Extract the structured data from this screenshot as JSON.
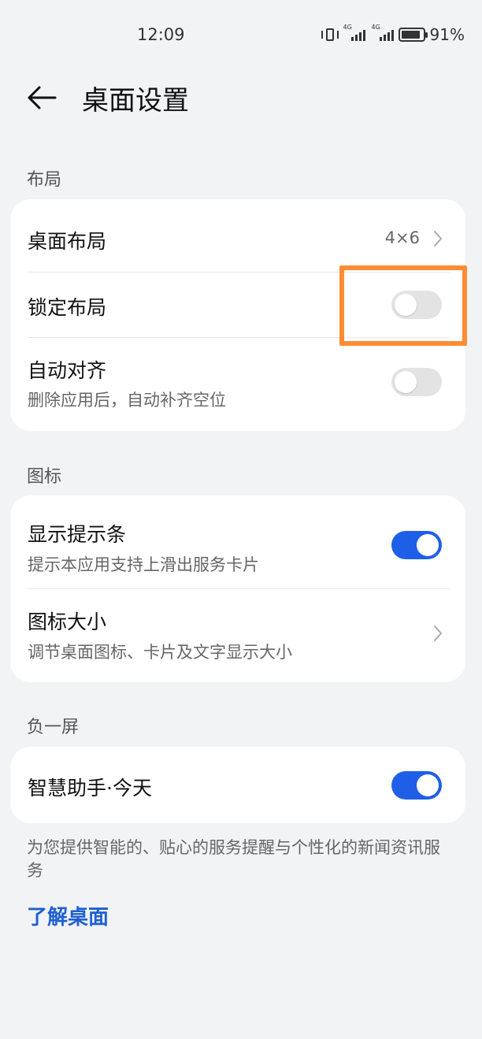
{
  "status_bar": {
    "time": "12:09",
    "battery_percent": "91%",
    "battery_level": 0.91,
    "network_labels": [
      "4G",
      "4G"
    ],
    "icons": [
      "vibrate-icon",
      "signal-icon",
      "signal-icon",
      "battery-icon"
    ]
  },
  "header": {
    "title": "桌面设置",
    "back_icon": "arrow-left-icon"
  },
  "sections": {
    "layout": {
      "header": "布局",
      "items": {
        "desktop_layout": {
          "title": "桌面布局",
          "value": "4×6"
        },
        "lock_layout": {
          "title": "锁定布局",
          "toggle": false
        },
        "auto_align": {
          "title": "自动对齐",
          "subtitle": "删除应用后，自动补齐空位",
          "toggle": false
        }
      }
    },
    "icons": {
      "header": "图标",
      "items": {
        "show_hint_bar": {
          "title": "显示提示条",
          "subtitle": "提示本应用支持上滑出服务卡片",
          "toggle": true
        },
        "icon_size": {
          "title": "图标大小",
          "subtitle": "调节桌面图标、卡片及文字显示大小"
        }
      }
    },
    "minus_one_screen": {
      "header": "负一屏",
      "items": {
        "smart_assistant": {
          "title": "智慧助手·今天",
          "toggle": true
        }
      }
    }
  },
  "footer": {
    "description": "为您提供智能的、贴心的服务提醒与个性化的新闻资讯服务",
    "link": "了解桌面"
  },
  "colors": {
    "background": "#f1f3f5",
    "card": "#ffffff",
    "toggle_on": "#1f5fe8",
    "toggle_off": "#e3e3e3",
    "link": "#1f5fd0",
    "highlight": "#ff8c33"
  }
}
